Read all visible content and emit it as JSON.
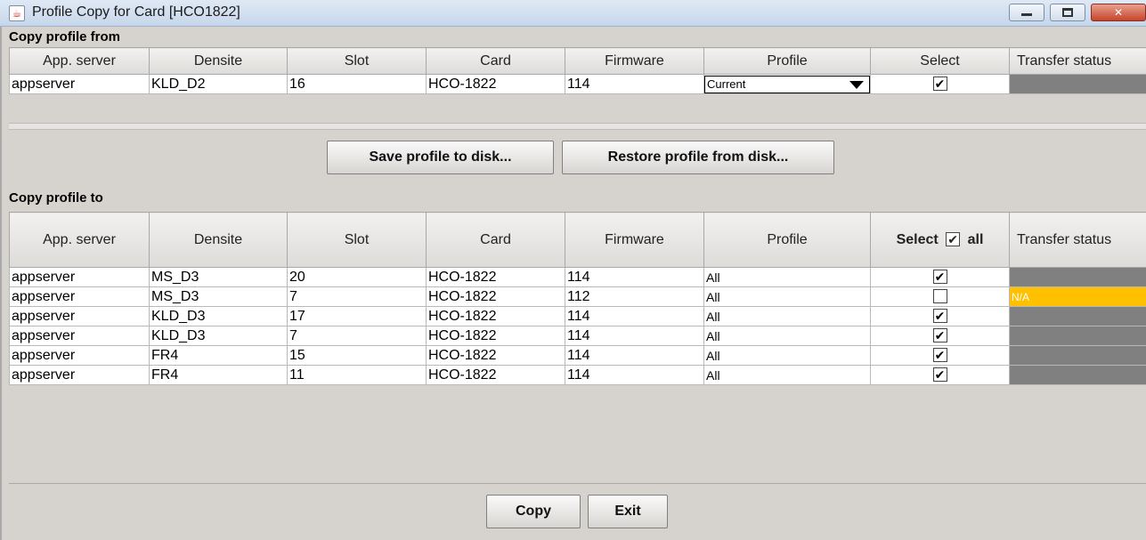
{
  "window": {
    "title": "Profile Copy for Card [HCO1822]",
    "icon": "java-cup-icon"
  },
  "from_section": {
    "label": "Copy profile from",
    "columns": [
      "App. server",
      "Densite",
      "Slot",
      "Card",
      "Firmware",
      "Profile",
      "Select",
      "Transfer status"
    ],
    "row": {
      "app_server": "appserver",
      "densite": "KLD_D2",
      "slot": "16",
      "card": "HCO-1822",
      "firmware": "114",
      "profile": "Current",
      "selected": "✔",
      "status": ""
    }
  },
  "buttons": {
    "save": "Save profile to disk...",
    "restore": "Restore profile from disk...",
    "copy": "Copy",
    "exit": "Exit"
  },
  "to_section": {
    "label": "Copy profile to",
    "columns": [
      "App. server",
      "Densite",
      "Slot",
      "Card",
      "Firmware",
      "Profile",
      "Select",
      "Transfer status"
    ],
    "select_all_label": "all",
    "select_all_checked": "✔",
    "rows": [
      {
        "app_server": "appserver",
        "densite": "MS_D3",
        "slot": "20",
        "card": "HCO-1822",
        "firmware": "114",
        "profile": "All",
        "selected": "✔",
        "status": ""
      },
      {
        "app_server": "appserver",
        "densite": "MS_D3",
        "slot": "7",
        "card": "HCO-1822",
        "firmware": "112",
        "profile": "All",
        "selected": "",
        "status": "N/A"
      },
      {
        "app_server": "appserver",
        "densite": "KLD_D3",
        "slot": "17",
        "card": "HCO-1822",
        "firmware": "114",
        "profile": "All",
        "selected": "✔",
        "status": ""
      },
      {
        "app_server": "appserver",
        "densite": "KLD_D3",
        "slot": "7",
        "card": "HCO-1822",
        "firmware": "114",
        "profile": "All",
        "selected": "✔",
        "status": ""
      },
      {
        "app_server": "appserver",
        "densite": "FR4",
        "slot": "15",
        "card": "HCO-1822",
        "firmware": "114",
        "profile": "All",
        "selected": "✔",
        "status": ""
      },
      {
        "app_server": "appserver",
        "densite": "FR4",
        "slot": "11",
        "card": "HCO-1822",
        "firmware": "114",
        "profile": "All",
        "selected": "✔",
        "status": ""
      }
    ]
  },
  "colors": {
    "status_default": "#808080",
    "status_na": "#ffc000",
    "close_button": "#c7442b"
  }
}
